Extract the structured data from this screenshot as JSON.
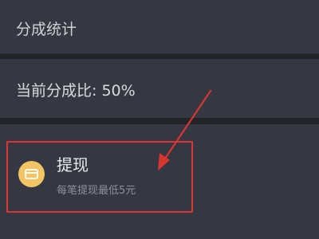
{
  "stats": {
    "title": "分成统计"
  },
  "ratio": {
    "text": "当前分成比: 50%"
  },
  "withdraw": {
    "title": "提现",
    "subtitle": "每笔提现最低5元",
    "icon": "card-icon",
    "icon_bg": "#f3c464"
  },
  "annotation": {
    "color": "#d8362e"
  }
}
